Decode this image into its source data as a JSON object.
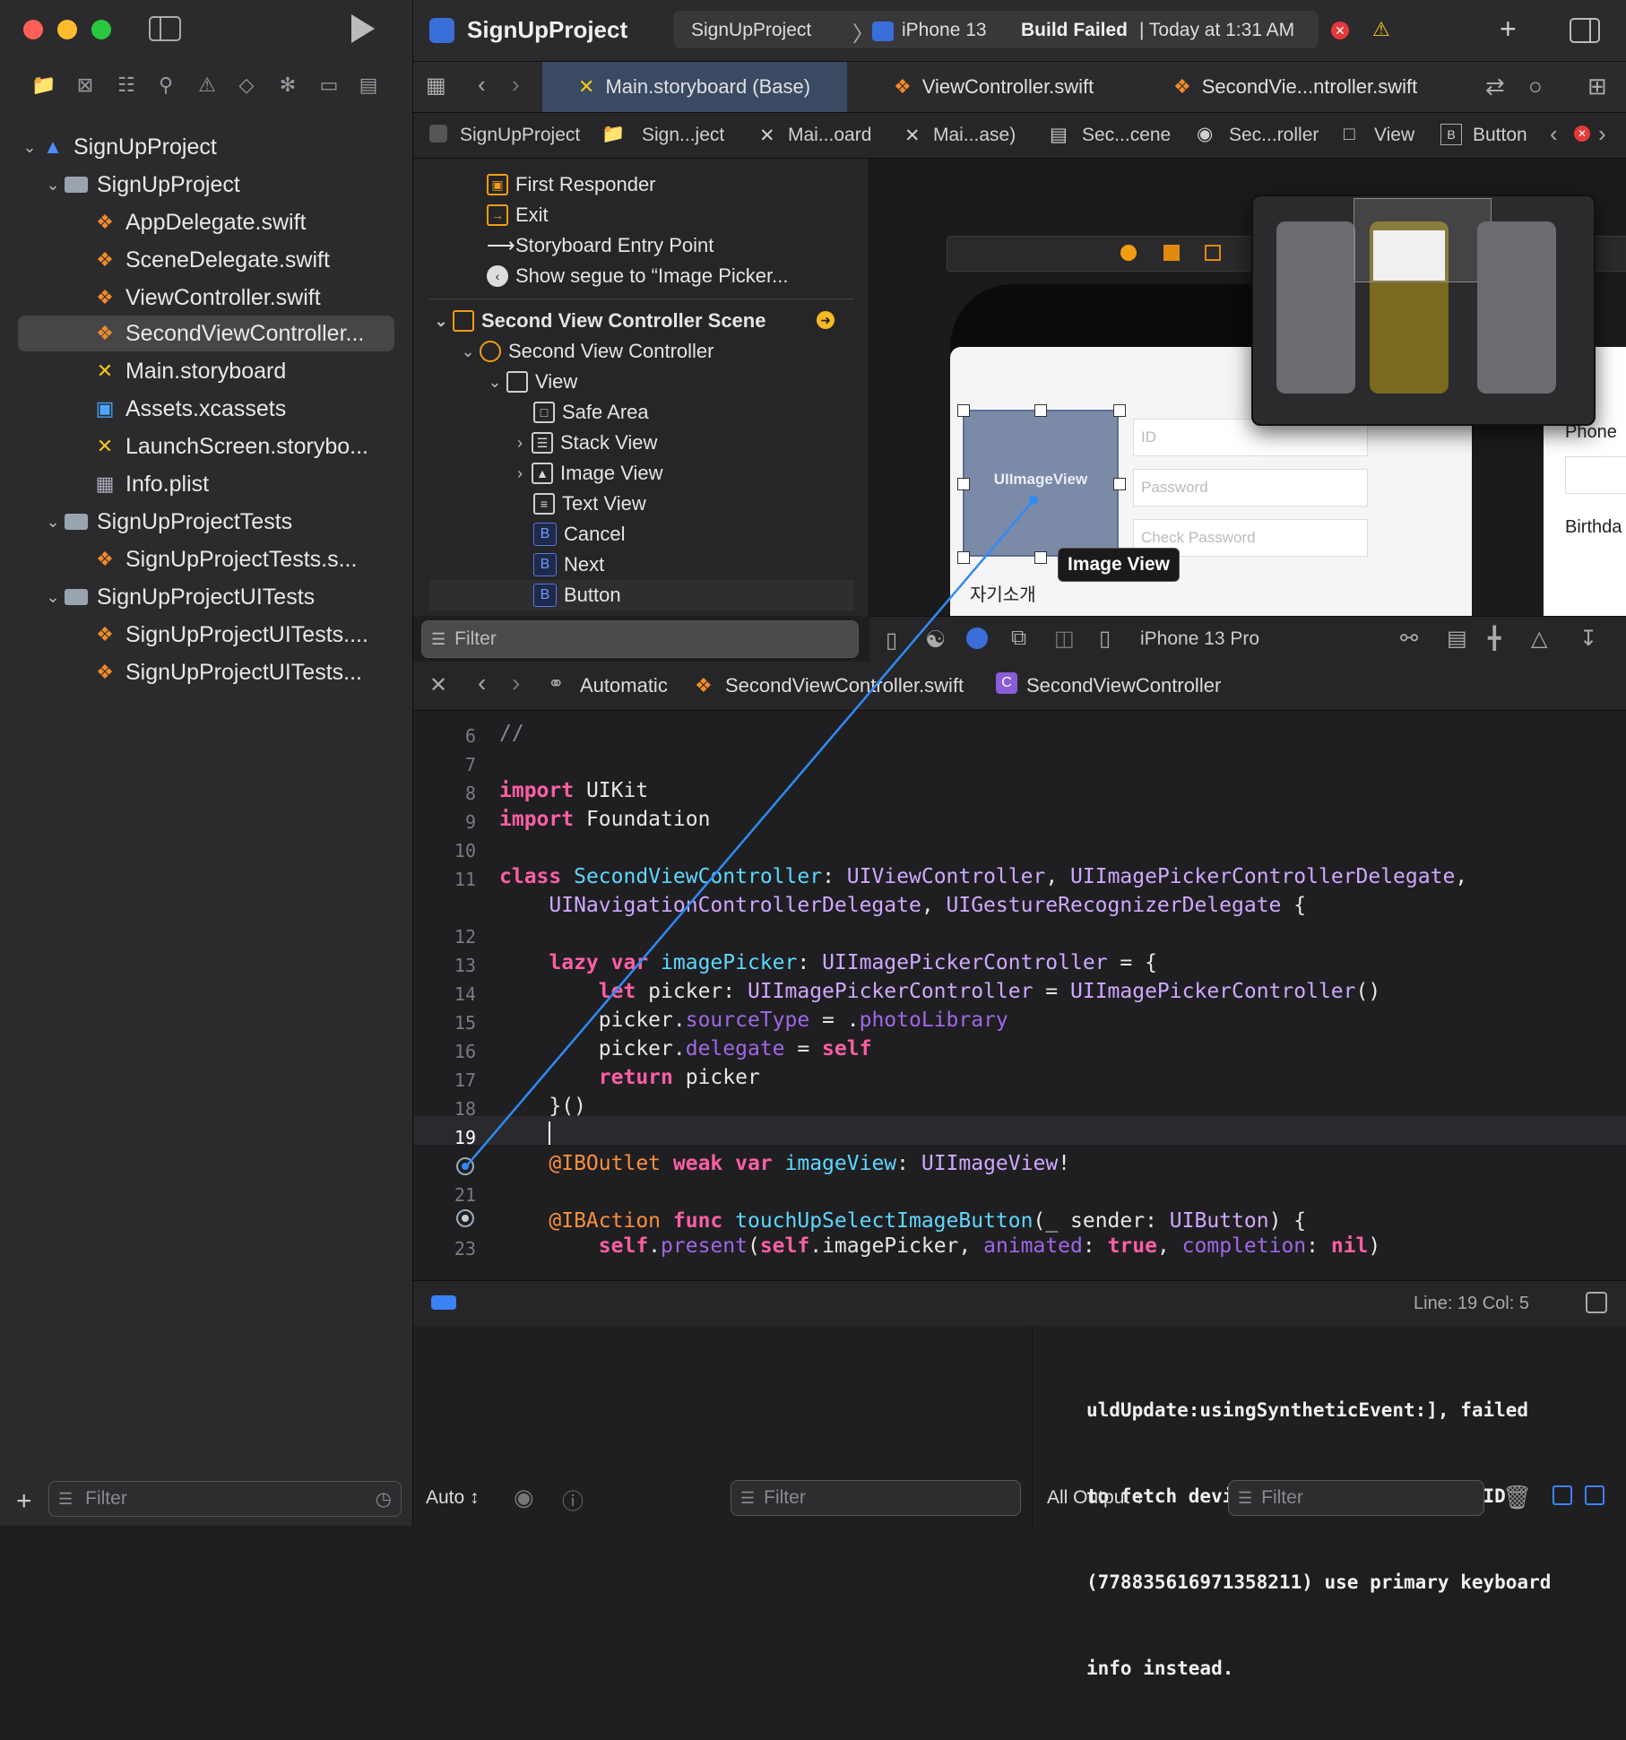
{
  "toolbar": {
    "project": "SignUpProject",
    "scheme": "SignUpProject",
    "device": "iPhone 13",
    "build_status": "Build Failed",
    "build_time": "| Today at 1:31 AM"
  },
  "tabs": [
    {
      "label": "Main.storyboard (Base)"
    },
    {
      "label": "ViewController.swift"
    },
    {
      "label": "SecondVie...ntroller.swift"
    }
  ],
  "breadcrumb1": [
    "SignUpProject",
    "Sign...ject",
    "Mai...oard",
    "Mai...ase)",
    "Sec...cene",
    "Sec...roller",
    "View",
    "Button"
  ],
  "navigator": {
    "items": [
      {
        "label": "SignUpProject"
      },
      {
        "label": "SignUpProject"
      },
      {
        "label": "AppDelegate.swift"
      },
      {
        "label": "SceneDelegate.swift"
      },
      {
        "label": "ViewController.swift"
      },
      {
        "label": "SecondViewController..."
      },
      {
        "label": "Main.storyboard"
      },
      {
        "label": "Assets.xcassets"
      },
      {
        "label": "LaunchScreen.storybo..."
      },
      {
        "label": "Info.plist"
      },
      {
        "label": "SignUpProjectTests"
      },
      {
        "label": "SignUpProjectTests.s..."
      },
      {
        "label": "SignUpProjectUITests"
      },
      {
        "label": "SignUpProjectUITests...."
      },
      {
        "label": "SignUpProjectUITests..."
      }
    ],
    "filter_placeholder": "Filter"
  },
  "outline": {
    "rows": [
      "First Responder",
      "Exit",
      "Storyboard Entry Point",
      "Show segue to “Image Picker...",
      "Second View Controller Scene",
      "Second View Controller",
      "View",
      "Safe Area",
      "Stack View",
      "Image View",
      "Text View",
      "Cancel",
      "Next",
      "Button"
    ],
    "filter_placeholder": "Filter"
  },
  "canvas": {
    "image_view_label": "UIImageView",
    "tooltip": "Image View",
    "field_id": "ID",
    "field_password": "Password",
    "field_check": "Check Password",
    "intro_label": "자기소개",
    "right_phone": "Phone",
    "right_birth": "Birthda",
    "device_config": "iPhone 13 Pro"
  },
  "editor_jump": {
    "mode": "Automatic",
    "file": "SecondViewController.swift",
    "symbol": "SecondViewController"
  },
  "status": {
    "position": "Line: 19  Col: 5"
  },
  "debug": {
    "auto_label": "Auto ↕",
    "all_output": "All Output ↕",
    "filter_placeholder": "Filter",
    "console_lines": [
      "uldUpdate:usingSyntheticEvent:], failed",
      "to fetch device property for senderID",
      "(778835616971358211) use primary keyboard",
      "info instead."
    ]
  },
  "colors": {
    "accent_blue": "#3b82f6",
    "error_red": "#e5393a",
    "warning_yellow": "#f5c518",
    "connection_line": "#2f8bf5"
  }
}
